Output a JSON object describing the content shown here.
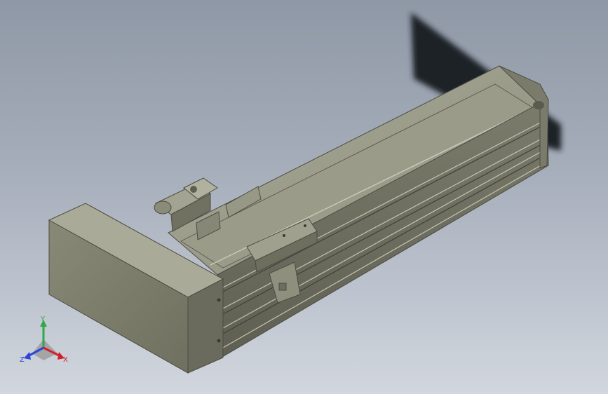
{
  "viewport": {
    "background_top": "#8f98a6",
    "background_bottom": "#d2d7de"
  },
  "model": {
    "body_color": "#8a8b78",
    "body_light": "#b4b5a3",
    "body_dark": "#5e5f52",
    "shadow_color": "#1e2127"
  },
  "triad": {
    "x_label": "X",
    "y_label": "Y",
    "z_label": "Z",
    "x_color": "#d0202a",
    "y_color": "#2fa84a",
    "z_color": "#2b45d8",
    "icon": "coordinate-triad-icon"
  }
}
